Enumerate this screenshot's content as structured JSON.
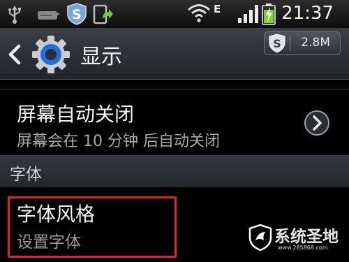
{
  "status_bar": {
    "network_type": "E",
    "time": "21:37"
  },
  "action_bar": {
    "title": "显示",
    "memory_badge": "2.8M"
  },
  "settings": {
    "screen_timeout": {
      "title": "屏幕自动关闭",
      "summary": "屏幕会在 10 分钟 后自动关闭"
    },
    "section_header": "字体",
    "font_style": {
      "title": "字体风格",
      "summary": "设置字体"
    }
  },
  "watermark": {
    "text": "系统圣地",
    "url": "www.285868.com"
  },
  "colors": {
    "highlight_border": "#e4202a",
    "section_bg": "#2c2f34",
    "settings_icon_blue": "#1e6fd9",
    "battery_green": "#7fd12b"
  },
  "icons": {
    "status": [
      "usb-icon",
      "voicemail-icon",
      "security-s-icon",
      "app-update-icon",
      "wifi-icon",
      "signal-icon",
      "battery-charging-icon"
    ],
    "action_bar": [
      "back-chevron-icon",
      "settings-gear-icon",
      "security-s-icon"
    ],
    "row": [
      "chevron-right-circle-icon"
    ],
    "watermark": [
      "shield-logo-icon"
    ]
  }
}
